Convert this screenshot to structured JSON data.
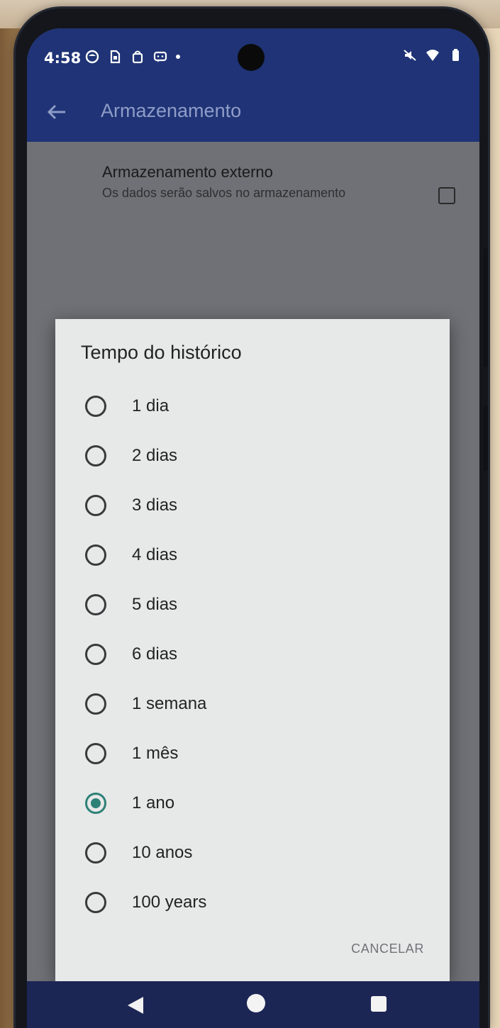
{
  "status_bar": {
    "time": "4:58",
    "left_icons": [
      "notification-app-icon",
      "sim-card-icon",
      "shopping-bag-icon",
      "message-icon",
      "more-notifications-dot-icon"
    ],
    "right_icons": [
      "mute-icon",
      "wifi-icon",
      "battery-icon"
    ]
  },
  "app_bar": {
    "title": "Armazenamento",
    "back_icon": "arrow-left-icon"
  },
  "background_preference": {
    "title": "Armazenamento externo",
    "summary": "Os dados serão salvos no armazenamento"
  },
  "dialog": {
    "title": "Tempo do histórico",
    "options": [
      {
        "label": "1 dia",
        "selected": false
      },
      {
        "label": "2 dias",
        "selected": false
      },
      {
        "label": "3 dias",
        "selected": false
      },
      {
        "label": "4 dias",
        "selected": false
      },
      {
        "label": "5 dias",
        "selected": false
      },
      {
        "label": "6 dias",
        "selected": false
      },
      {
        "label": "1 semana",
        "selected": false
      },
      {
        "label": "1 mês",
        "selected": false
      },
      {
        "label": "1 ano",
        "selected": true
      },
      {
        "label": "10 anos",
        "selected": false
      },
      {
        "label": "100 years",
        "selected": false
      }
    ],
    "cancel_label": "CANCELAR"
  },
  "nav_bar": {
    "buttons": [
      "back-icon",
      "home-icon",
      "recents-icon"
    ]
  },
  "colors": {
    "app_bar": "#1f3376",
    "accent_radio": "#2d8176",
    "dialog_bg": "#e7e8e8",
    "scrim": "#6f7176"
  }
}
